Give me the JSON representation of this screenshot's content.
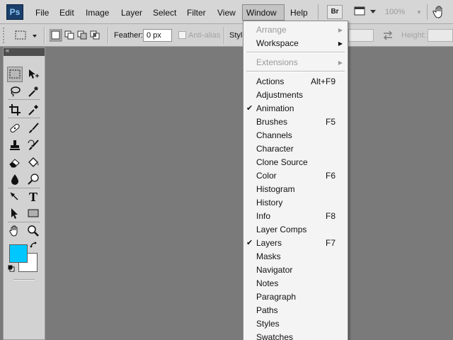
{
  "menubar": {
    "logo": "Ps",
    "items": [
      "File",
      "Edit",
      "Image",
      "Layer",
      "Select",
      "Filter",
      "View",
      "Window",
      "Help"
    ],
    "bridge_label": "Br",
    "zoom": "100%",
    "active_menu": "Window"
  },
  "options": {
    "feather_label": "Feather:",
    "feather_value": "0 px",
    "antialias_label": "Anti-alias",
    "style_label": "Style",
    "height_label": "Height:"
  },
  "tools": {
    "foreground_color": "#00c8ff",
    "background_color": "#ffffff",
    "type_tool_glyph": "T"
  },
  "window_menu": {
    "items": [
      {
        "label": "Arrange",
        "disabled": true,
        "submenu": true
      },
      {
        "label": "Workspace",
        "submenu": true
      },
      {
        "separator": true
      },
      {
        "label": "Extensions",
        "disabled": true,
        "submenu": true
      },
      {
        "separator": true
      },
      {
        "label": "Actions",
        "shortcut": "Alt+F9"
      },
      {
        "label": "Adjustments"
      },
      {
        "label": "Animation",
        "checked": true
      },
      {
        "label": "Brushes",
        "shortcut": "F5"
      },
      {
        "label": "Channels"
      },
      {
        "label": "Character"
      },
      {
        "label": "Clone Source"
      },
      {
        "label": "Color",
        "shortcut": "F6"
      },
      {
        "label": "Histogram"
      },
      {
        "label": "History"
      },
      {
        "label": "Info",
        "shortcut": "F8"
      },
      {
        "label": "Layer Comps"
      },
      {
        "label": "Layers",
        "shortcut": "F7",
        "checked": true
      },
      {
        "label": "Masks"
      },
      {
        "label": "Navigator"
      },
      {
        "label": "Notes"
      },
      {
        "label": "Paragraph"
      },
      {
        "label": "Paths"
      },
      {
        "label": "Styles"
      },
      {
        "label": "Swatches"
      }
    ]
  }
}
